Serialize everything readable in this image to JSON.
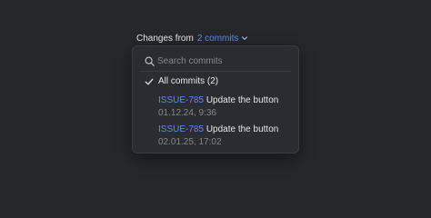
{
  "header": {
    "label": "Changes from",
    "selector_label": "2 commits",
    "selector_icon": "chevron-down-icon"
  },
  "dropdown": {
    "search": {
      "placeholder": "Search commits",
      "value": "",
      "icon": "search-icon"
    },
    "all_commits": {
      "label": "All commits (2)",
      "selected": true,
      "icon": "check-icon"
    },
    "commits": [
      {
        "issue": "ISSUE-785",
        "message": "Update the button",
        "date": "01.12.24, 9:36"
      },
      {
        "issue": "ISSUE-785",
        "message": "Update the button",
        "date": "02.01.25, 17:02"
      }
    ]
  },
  "colors": {
    "background": "#26272b",
    "panel": "#2b2c31",
    "accent": "#5b8def",
    "text": "#e8e8ea",
    "muted": "#85868c"
  }
}
